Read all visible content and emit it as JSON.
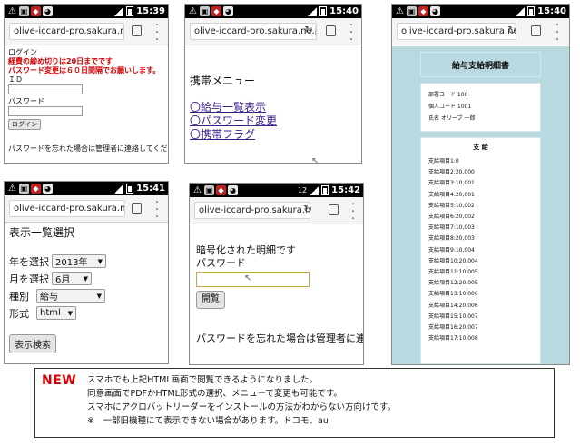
{
  "status": {
    "time1": "15:39",
    "time2": "15:40",
    "time3": "15:40",
    "time4": "15:41",
    "time5": "15:42",
    "extra5": "12"
  },
  "url": "olive-iccard-pro.sakura.ne.jp/we",
  "icons": {
    "status_left": [
      "warning-icon",
      "signal-box-icon",
      "shield-icon",
      "cat-icon"
    ],
    "browser": [
      "reload-icon",
      "tabs-icon",
      "overflow-menu-icon"
    ]
  },
  "login": {
    "title": "ログイン",
    "note1": "経費の締め切りは20日までです",
    "note2": "パスワード変更は６０日間隔でお願いします。",
    "id_label": "ＩＤ",
    "pw_label": "パスワード",
    "login_button": "ログイン",
    "forgot": "パスワードを忘れた場合は管理者に連絡してください"
  },
  "menu": {
    "title": "携帯メニュー",
    "items": [
      "〇給与一覧表示",
      "〇パスワード変更",
      "〇携帯フラグ"
    ]
  },
  "payslip": {
    "title": "給与支給明細書",
    "dept": "部署コード 100",
    "person": "個人コード 1001",
    "name": "氏名 オリーブ 一郎",
    "section": "支 給",
    "items": [
      "支給項目1:0",
      "支給項目2:20,000",
      "支給項目3:10,001",
      "支給項目4:20,001",
      "支給項目5:10,002",
      "支給項目6:20,002",
      "支給項目7:10,003",
      "支給項目8:20,003",
      "支給項目9:10,004",
      "支給項目10:20,004",
      "支給項目11:10,005",
      "支給項目12:20,005",
      "支給項目13:10,006",
      "支給項目14:20,006",
      "支給項目15:10,007",
      "支給項目16:20,007",
      "支給項目17:10,008"
    ]
  },
  "select": {
    "title": "表示一覧選択",
    "year_label": "年を選択",
    "year_value": "2013年",
    "month_label": "月を選択",
    "month_value": "6月",
    "type_label": "種別",
    "type_value": "給与",
    "format_label": "形式",
    "format_value": "html",
    "button": "表示検索"
  },
  "encrypted": {
    "title": "暗号化された明細です",
    "pw_label": "パスワード",
    "open_button": "開覧",
    "forgot": "パスワードを忘れた場合は管理者に連"
  },
  "notice": {
    "badge": "NEW",
    "lines": [
      "スマホでも上記HTML画面で閲覧できるようになりました。",
      "同意画面でPDFかHTML形式の選択、メニューで変更も可能です。",
      "スマホにアクロバットリーダーをインストールの方法がわからない方向けです。",
      "※　一部旧機種にて表示できない場合があります。ドコモ、au"
    ]
  }
}
